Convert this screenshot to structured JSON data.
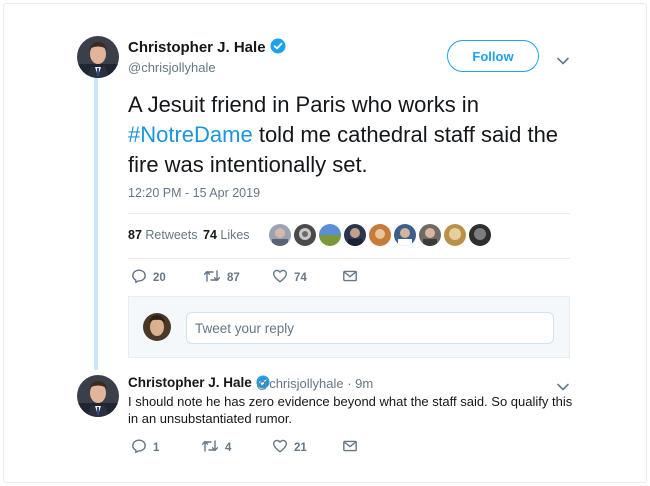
{
  "main_tweet": {
    "author_name": "Christopher J. Hale",
    "handle": "@chrisjollyhale",
    "follow_label": "Follow",
    "text_before": "A Jesuit friend in Paris who works in",
    "hashtag": "#NotreDame",
    "text_after": " told me cathedral staff said the fire was intentionally set.",
    "timestamp": "12:20 PM - 15 Apr 2019",
    "retweets_count": "87",
    "retweets_label": " Retweets",
    "likes_count": "74",
    "likes_label": " Likes",
    "liker_avatars": 9,
    "actions": {
      "reply_count": "20",
      "retweet_count": "87",
      "like_count": "74"
    }
  },
  "reply_composer": {
    "placeholder": "Tweet your reply"
  },
  "reply": {
    "author_name": "Christopher J. Hale",
    "handle_time": "@chrisjollyhale · 9m",
    "text": "I should note he has zero evidence beyond what the staff said. So qualify this in an unsubstantiated rumor.",
    "actions": {
      "reply_count": "1",
      "retweet_count": "4",
      "like_count": "21"
    }
  },
  "colors": {
    "accent": "#1da1f2",
    "hashtag": "#1b95e0",
    "secondary_text": "#657786",
    "thread_line": "#cce6f8"
  }
}
